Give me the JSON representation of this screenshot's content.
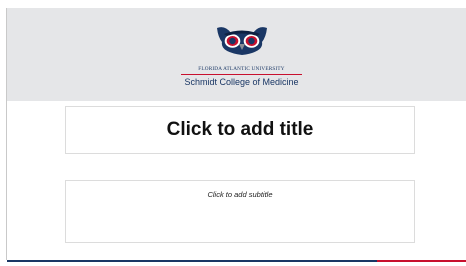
{
  "header": {
    "logo_icon": "owl-logo-icon",
    "university_name": "FLORIDA ATLANTIC UNIVERSITY",
    "college_name": "Schmidt College of Medicine"
  },
  "placeholders": {
    "title": "Click to add title",
    "subtitle": "Click to add subtitle"
  },
  "colors": {
    "header_band": "#e5e6e8",
    "brand_blue": "#1a3765",
    "brand_red": "#c8102e"
  }
}
